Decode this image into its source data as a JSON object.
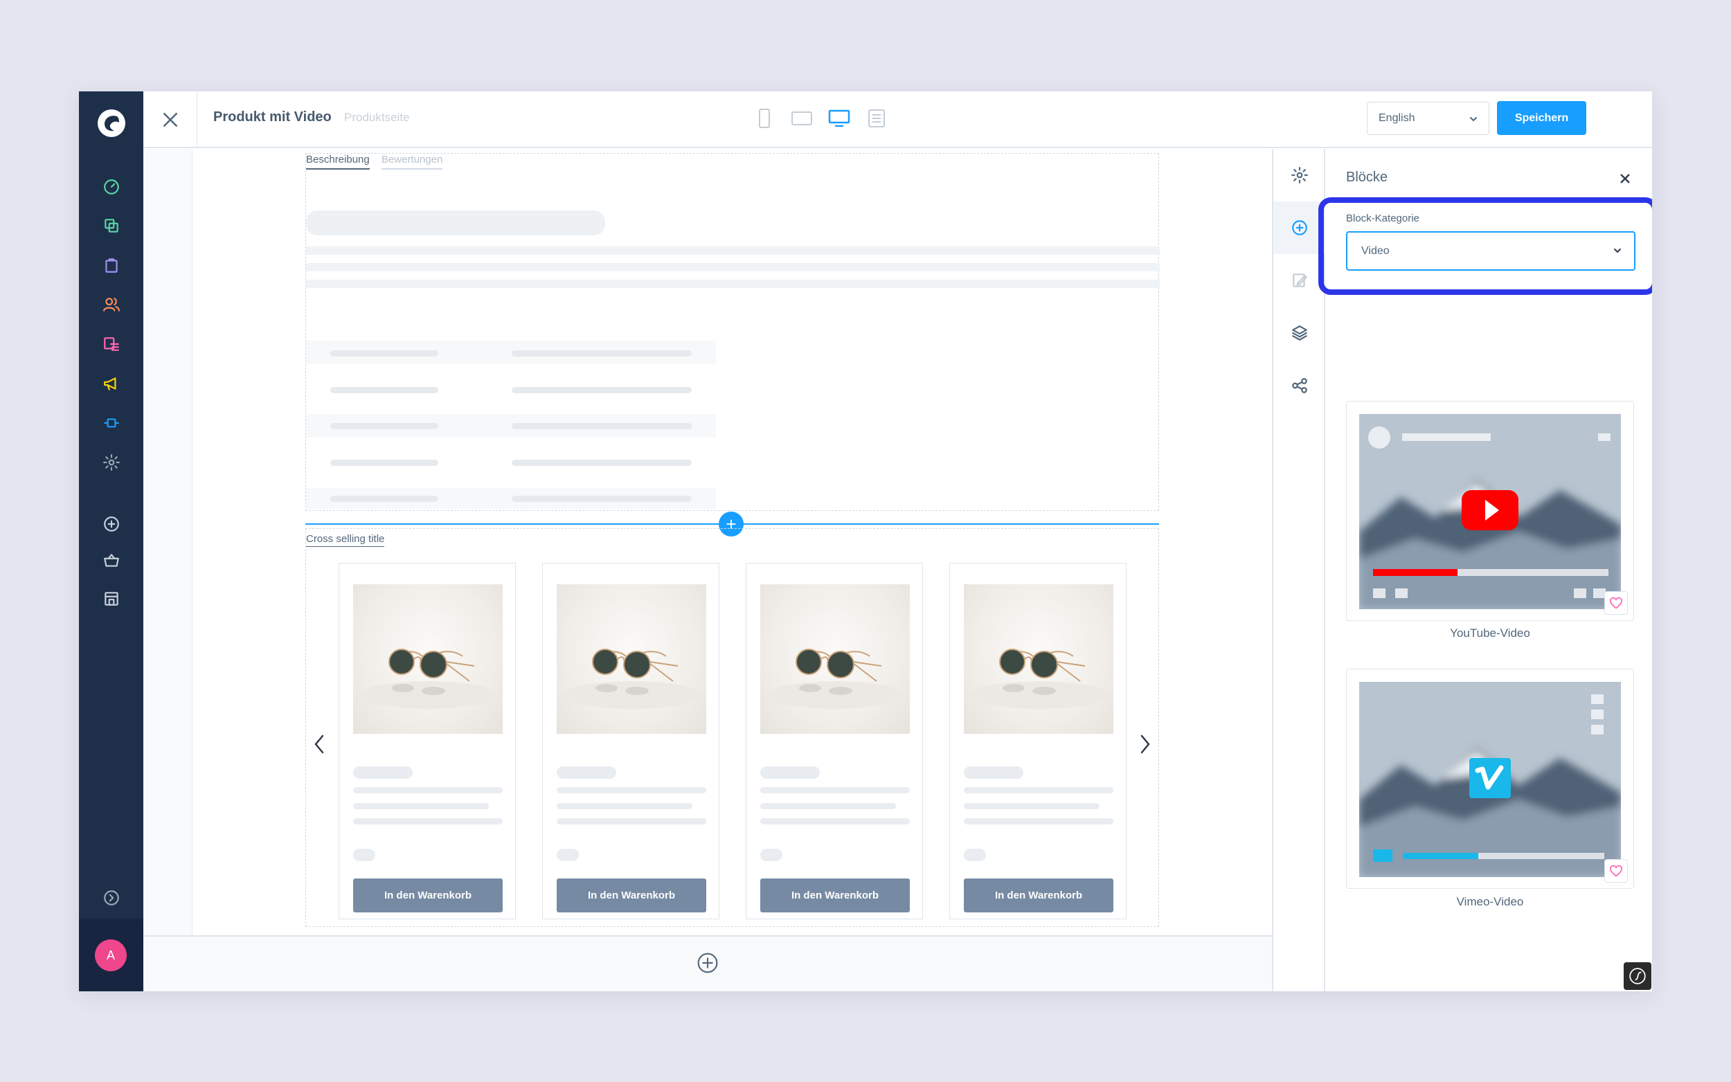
{
  "header": {
    "title": "Produkt mit Video",
    "subtitle": "Produktseite",
    "language": "English",
    "save_label": "Speichern"
  },
  "sidebar": {
    "avatar_initial": "A",
    "items": [
      {
        "icon": "dashboard-icon",
        "color": "#57d9a3"
      },
      {
        "icon": "catalogue-icon",
        "color": "#57d9a3"
      },
      {
        "icon": "orders-icon",
        "color": "#a092f0"
      },
      {
        "icon": "customers-icon",
        "color": "#ff8c5a"
      },
      {
        "icon": "content-icon",
        "color": "#ff68b4"
      },
      {
        "icon": "marketing-icon",
        "color": "#ffd700"
      },
      {
        "icon": "extensions-icon",
        "color": "#189eff"
      },
      {
        "icon": "settings-icon",
        "color": "#9aa8b5"
      }
    ]
  },
  "canvas": {
    "tabs": [
      "Beschreibung",
      "Bewertungen"
    ],
    "cross_selling_title": "Cross selling title",
    "cards": [
      {
        "button": "In den Warenkorb"
      },
      {
        "button": "In den Warenkorb"
      },
      {
        "button": "In den Warenkorb"
      },
      {
        "button": "In den Warenkorb"
      }
    ]
  },
  "panel": {
    "title": "Blöcke",
    "category_label": "Block-Kategorie",
    "category_value": "Video",
    "blocks": [
      {
        "label": "YouTube-Video"
      },
      {
        "label": "Vimeo-Video"
      }
    ]
  },
  "colors": {
    "accent": "#189eff",
    "highlight": "#2d35e8",
    "sidebar": "#1e2f4a",
    "youtube": "#ff0000",
    "vimeo": "#1ab7ea"
  }
}
